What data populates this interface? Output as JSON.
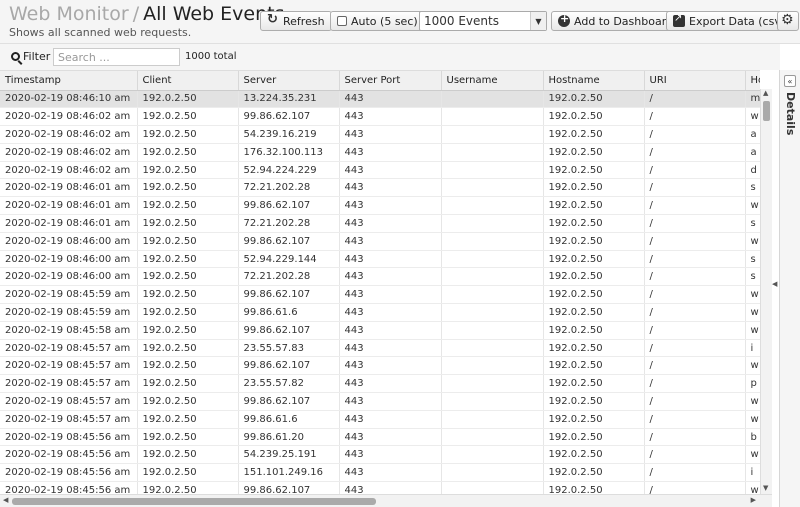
{
  "header": {
    "crumb": "Web Monitor",
    "separator": "/",
    "title": "All Web Events",
    "subtitle": "Shows all scanned web requests."
  },
  "toolbar": {
    "refresh_label": "Refresh",
    "auto_label": "Auto (5 sec)",
    "events_select": "1000 Events",
    "add_dashboard_label": "Add to Dashboard",
    "export_label": "Export Data (csv)"
  },
  "filter": {
    "label": "Filter",
    "placeholder": "Search ...",
    "total": "1000 total"
  },
  "table": {
    "columns": [
      "Timestamp",
      "Client",
      "Server",
      "Server Port",
      "Username",
      "Hostname",
      "URI",
      "Host"
    ],
    "rows": [
      [
        "2020-02-19 08:46:10 am",
        "192.0.2.50",
        "13.224.35.231",
        "443",
        "",
        "192.0.2.50",
        "/",
        "m"
      ],
      [
        "2020-02-19 08:46:02 am",
        "192.0.2.50",
        "99.86.62.107",
        "443",
        "",
        "192.0.2.50",
        "/",
        "w"
      ],
      [
        "2020-02-19 08:46:02 am",
        "192.0.2.50",
        "54.239.16.219",
        "443",
        "",
        "192.0.2.50",
        "/",
        "a"
      ],
      [
        "2020-02-19 08:46:02 am",
        "192.0.2.50",
        "176.32.100.113",
        "443",
        "",
        "192.0.2.50",
        "/",
        "a"
      ],
      [
        "2020-02-19 08:46:02 am",
        "192.0.2.50",
        "52.94.224.229",
        "443",
        "",
        "192.0.2.50",
        "/",
        "d"
      ],
      [
        "2020-02-19 08:46:01 am",
        "192.0.2.50",
        "72.21.202.28",
        "443",
        "",
        "192.0.2.50",
        "/",
        "s"
      ],
      [
        "2020-02-19 08:46:01 am",
        "192.0.2.50",
        "99.86.62.107",
        "443",
        "",
        "192.0.2.50",
        "/",
        "w"
      ],
      [
        "2020-02-19 08:46:01 am",
        "192.0.2.50",
        "72.21.202.28",
        "443",
        "",
        "192.0.2.50",
        "/",
        "s"
      ],
      [
        "2020-02-19 08:46:00 am",
        "192.0.2.50",
        "99.86.62.107",
        "443",
        "",
        "192.0.2.50",
        "/",
        "w"
      ],
      [
        "2020-02-19 08:46:00 am",
        "192.0.2.50",
        "52.94.229.144",
        "443",
        "",
        "192.0.2.50",
        "/",
        "s"
      ],
      [
        "2020-02-19 08:46:00 am",
        "192.0.2.50",
        "72.21.202.28",
        "443",
        "",
        "192.0.2.50",
        "/",
        "s"
      ],
      [
        "2020-02-19 08:45:59 am",
        "192.0.2.50",
        "99.86.62.107",
        "443",
        "",
        "192.0.2.50",
        "/",
        "w"
      ],
      [
        "2020-02-19 08:45:59 am",
        "192.0.2.50",
        "99.86.61.6",
        "443",
        "",
        "192.0.2.50",
        "/",
        "w"
      ],
      [
        "2020-02-19 08:45:58 am",
        "192.0.2.50",
        "99.86.62.107",
        "443",
        "",
        "192.0.2.50",
        "/",
        "w"
      ],
      [
        "2020-02-19 08:45:57 am",
        "192.0.2.50",
        "23.55.57.83",
        "443",
        "",
        "192.0.2.50",
        "/",
        "i"
      ],
      [
        "2020-02-19 08:45:57 am",
        "192.0.2.50",
        "99.86.62.107",
        "443",
        "",
        "192.0.2.50",
        "/",
        "w"
      ],
      [
        "2020-02-19 08:45:57 am",
        "192.0.2.50",
        "23.55.57.82",
        "443",
        "",
        "192.0.2.50",
        "/",
        "p"
      ],
      [
        "2020-02-19 08:45:57 am",
        "192.0.2.50",
        "99.86.62.107",
        "443",
        "",
        "192.0.2.50",
        "/",
        "w"
      ],
      [
        "2020-02-19 08:45:57 am",
        "192.0.2.50",
        "99.86.61.6",
        "443",
        "",
        "192.0.2.50",
        "/",
        "w"
      ],
      [
        "2020-02-19 08:45:56 am",
        "192.0.2.50",
        "99.86.61.20",
        "443",
        "",
        "192.0.2.50",
        "/",
        "b"
      ],
      [
        "2020-02-19 08:45:56 am",
        "192.0.2.50",
        "54.239.25.191",
        "443",
        "",
        "192.0.2.50",
        "/",
        "w"
      ],
      [
        "2020-02-19 08:45:56 am",
        "192.0.2.50",
        "151.101.249.16",
        "443",
        "",
        "192.0.2.50",
        "/",
        "i"
      ],
      [
        "2020-02-19 08:45:56 am",
        "192.0.2.50",
        "99.86.62.107",
        "443",
        "",
        "192.0.2.50",
        "/",
        "w"
      ]
    ]
  },
  "details": {
    "label": "Details"
  }
}
